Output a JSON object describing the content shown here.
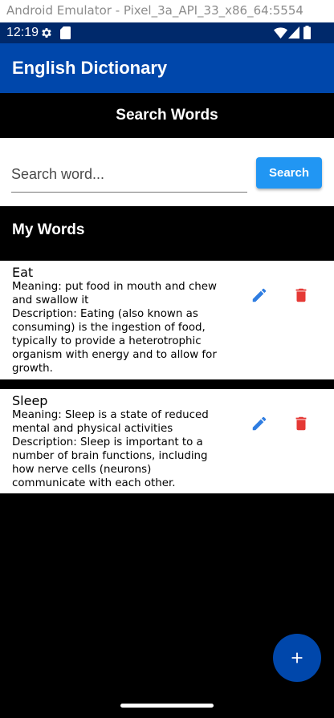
{
  "window": {
    "title": "Android Emulator - Pixel_3a_API_33_x86_64:5554"
  },
  "status_bar": {
    "time": "12:19",
    "icons": [
      "gear-icon",
      "sd-card-icon",
      "wifi-icon",
      "signal-icon",
      "battery-icon"
    ],
    "background": "#00296b"
  },
  "app_bar": {
    "title": "English Dictionary",
    "background": "#0047ab"
  },
  "search_section": {
    "header": "Search Words",
    "input_value": "",
    "placeholder": "Search word...",
    "button_label": "Search",
    "button_color": "#2196f3"
  },
  "words_section": {
    "header": "My Words",
    "words": [
      {
        "title": "Eat",
        "meaning": "Meaning: put food in mouth and chew and swallow it",
        "description": "Description: Eating (also known as consuming) is the ingestion of food, typically to provide a heterotrophic organism with energy and to allow for growth."
      },
      {
        "title": "Sleep",
        "meaning": "Meaning: Sleep is a state of reduced mental and physical activities",
        "description": "Description: Sleep is important to a number of brain functions, including how nerve cells (neurons) communicate with each other."
      }
    ],
    "edit_icon": "pencil-icon",
    "delete_icon": "trash-icon",
    "edit_color": "#2f7de1",
    "delete_color": "#e53935"
  },
  "fab": {
    "icon": "plus-icon",
    "background": "#0047ab"
  }
}
